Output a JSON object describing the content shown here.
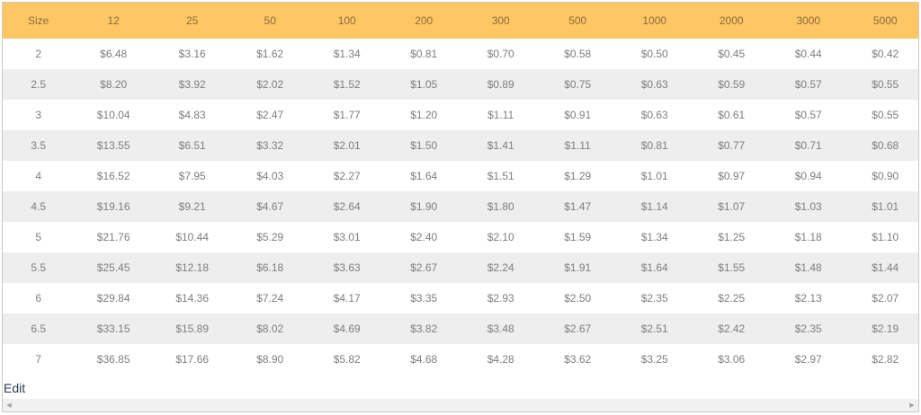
{
  "table": {
    "headers": [
      "Size",
      "12",
      "25",
      "50",
      "100",
      "200",
      "300",
      "500",
      "1000",
      "2000",
      "3000",
      "5000"
    ],
    "rows": [
      [
        "2",
        "$6.48",
        "$3.16",
        "$1.62",
        "$1.34",
        "$0.81",
        "$0.70",
        "$0.58",
        "$0.50",
        "$0.45",
        "$0.44",
        "$0.42"
      ],
      [
        "2.5",
        "$8.20",
        "$3.92",
        "$2.02",
        "$1.52",
        "$1.05",
        "$0.89",
        "$0.75",
        "$0.63",
        "$0.59",
        "$0.57",
        "$0.55"
      ],
      [
        "3",
        "$10.04",
        "$4.83",
        "$2.47",
        "$1.77",
        "$1.20",
        "$1.11",
        "$0.91",
        "$0.63",
        "$0.61",
        "$0.57",
        "$0.55"
      ],
      [
        "3.5",
        "$13.55",
        "$6.51",
        "$3.32",
        "$2.01",
        "$1.50",
        "$1.41",
        "$1.11",
        "$0.81",
        "$0.77",
        "$0.71",
        "$0.68"
      ],
      [
        "4",
        "$16.52",
        "$7.95",
        "$4.03",
        "$2.27",
        "$1.64",
        "$1.51",
        "$1.29",
        "$1.01",
        "$0.97",
        "$0.94",
        "$0.90"
      ],
      [
        "4.5",
        "$19.16",
        "$9.21",
        "$4.67",
        "$2.64",
        "$1.90",
        "$1.80",
        "$1.47",
        "$1.14",
        "$1.07",
        "$1.03",
        "$1.01"
      ],
      [
        "5",
        "$21.76",
        "$10.44",
        "$5.29",
        "$3.01",
        "$2.40",
        "$2.10",
        "$1.59",
        "$1.34",
        "$1.25",
        "$1.18",
        "$1.10"
      ],
      [
        "5.5",
        "$25.45",
        "$12.18",
        "$6.18",
        "$3.63",
        "$2.67",
        "$2.24",
        "$1.91",
        "$1.64",
        "$1.55",
        "$1.48",
        "$1.44"
      ],
      [
        "6",
        "$29.84",
        "$14.36",
        "$7.24",
        "$4.17",
        "$3.35",
        "$2.93",
        "$2.50",
        "$2.35",
        "$2.25",
        "$2.13",
        "$2.07"
      ],
      [
        "6.5",
        "$33.15",
        "$15.89",
        "$8.02",
        "$4.69",
        "$3.82",
        "$3.48",
        "$2.67",
        "$2.51",
        "$2.42",
        "$2.35",
        "$2.19"
      ],
      [
        "7",
        "$36.85",
        "$17.66",
        "$8.90",
        "$5.82",
        "$4.68",
        "$4.28",
        "$3.62",
        "$3.25",
        "$3.06",
        "$2.97",
        "$2.82"
      ]
    ]
  },
  "edit_label": "Edit",
  "scrollbar": {
    "left_arrow_icon": "◀",
    "right_arrow_icon": "▶"
  },
  "colors": {
    "header_background": "#fec763",
    "header_text": "#8a6b3e",
    "striped_row": "#eeeeee",
    "cell_text": "#7e7e7e",
    "edit_link": "#2b3a56"
  }
}
